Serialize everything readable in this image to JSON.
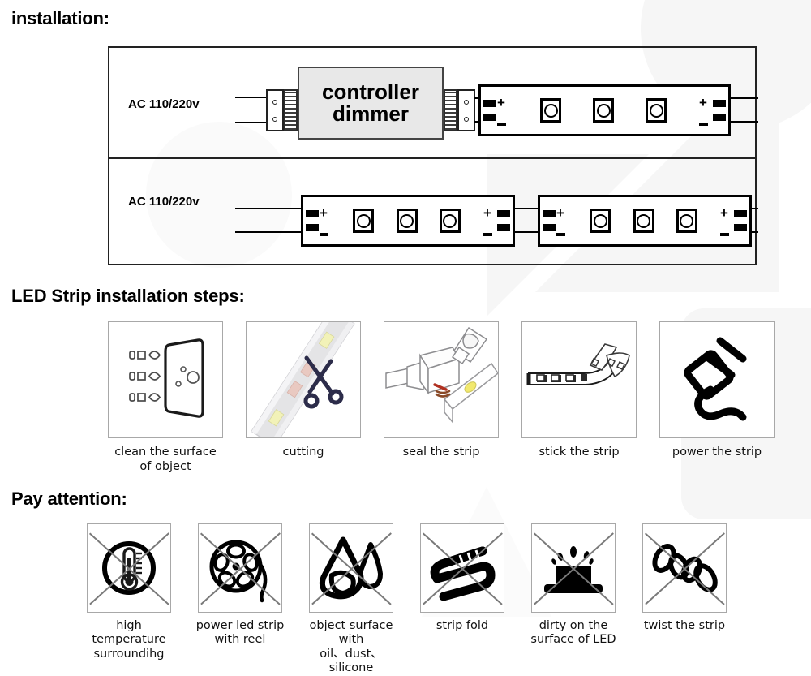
{
  "headings": {
    "installation": "installation:",
    "steps": "LED Strip installation steps:",
    "attention": "Pay attention:"
  },
  "wiring": {
    "row1": {
      "ac_label": "AC 110/220v",
      "controller_line1": "controller",
      "controller_line2": "dimmer",
      "strip": {
        "in_plus": "+",
        "in_minus": "−",
        "out_plus": "+",
        "out_minus": "−",
        "led_count": 3
      }
    },
    "row2": {
      "ac_label": "AC 110/220v",
      "strip_a": {
        "in_plus": "+",
        "in_minus": "−",
        "out_plus": "+",
        "out_minus": "−",
        "led_count": 3
      },
      "strip_b": {
        "in_plus": "+",
        "in_minus": "−",
        "out_plus": "+",
        "out_minus": "−",
        "led_count": 3
      }
    }
  },
  "steps": [
    {
      "icon": "clean-surface-icon",
      "caption": "clean the surface\nof object"
    },
    {
      "icon": "scissors-cutting-icon",
      "caption": "cutting"
    },
    {
      "icon": "seal-glue-icon",
      "caption": "seal the strip"
    },
    {
      "icon": "adhesive-strip-icon",
      "caption": "stick the strip"
    },
    {
      "icon": "power-plug-icon",
      "caption": "power the strip"
    }
  ],
  "warnings": [
    {
      "icon": "thermometer-icon",
      "caption": "high temperature\nsurroundihg"
    },
    {
      "icon": "reel-icon",
      "caption": "power led strip\nwith reel"
    },
    {
      "icon": "water-droplet-icon",
      "caption": "object surface with\noil、dust、silicone"
    },
    {
      "icon": "folded-strip-icon",
      "caption": "strip fold"
    },
    {
      "icon": "dirty-led-icon",
      "caption": "dirty on the\nsurface of LED"
    },
    {
      "icon": "twisted-strip-icon",
      "caption": "twist the strip"
    }
  ],
  "colors": {
    "ink": "#000000",
    "frame": "#222222",
    "controller_fill": "#e8e8e8",
    "card_border": "#a8a8a8",
    "cross": "#7a7a7a",
    "scissors": "#2c2c4a",
    "watermark": "#f6f6f6"
  }
}
